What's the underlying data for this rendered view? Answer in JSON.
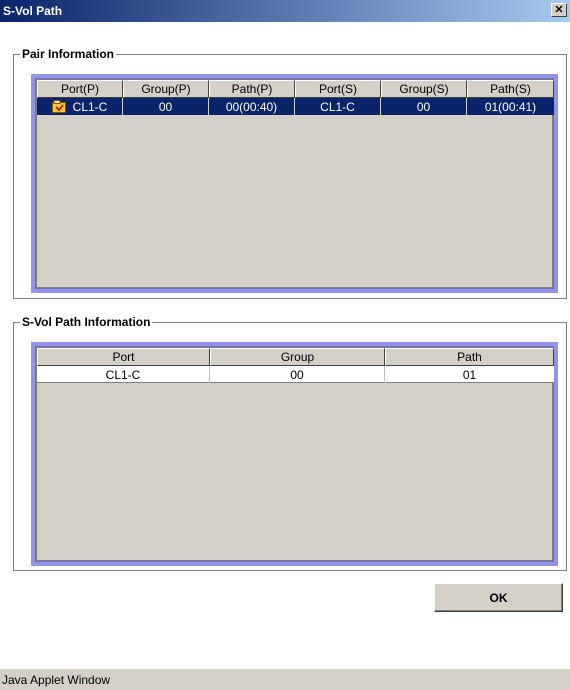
{
  "window": {
    "title": "S-Vol Path",
    "close_glyph": "✕"
  },
  "pair_info": {
    "legend": "Pair Information",
    "columns": [
      "Port(P)",
      "Group(P)",
      "Path(P)",
      "Port(S)",
      "Group(S)",
      "Path(S)"
    ],
    "rows": [
      {
        "icon": "pair-volume-icon",
        "cells": [
          "CL1-C",
          "00",
          "00(00:40)",
          "CL1-C",
          "00",
          "01(00:41)"
        ]
      }
    ]
  },
  "svol_path_info": {
    "legend": "S-Vol Path Information",
    "columns": [
      "Port",
      "Group",
      "Path"
    ],
    "rows": [
      {
        "cells": [
          "CL1-C",
          "00",
          "01"
        ]
      }
    ]
  },
  "ok_button": {
    "label": "OK"
  },
  "status_bar": {
    "text": "Java Applet Window"
  },
  "colors": {
    "selection": "#0a246a",
    "table_frame": "#9393e8",
    "panel": "#d4d0c8"
  }
}
